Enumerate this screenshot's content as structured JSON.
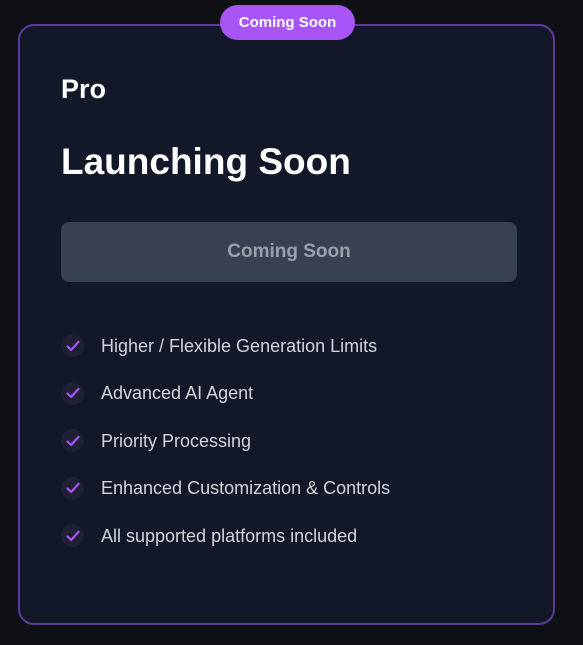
{
  "badge": {
    "label": "Coming Soon"
  },
  "plan": {
    "name": "Pro",
    "headline": "Launching Soon",
    "cta_label": "Coming Soon"
  },
  "features": [
    {
      "label": "Higher / Flexible Generation Limits",
      "icon": "check-icon"
    },
    {
      "label": "Advanced AI Agent",
      "icon": "check-icon"
    },
    {
      "label": "Priority Processing",
      "icon": "check-icon"
    },
    {
      "label": "Enhanced Customization & Controls",
      "icon": "check-icon"
    },
    {
      "label": "All supported platforms included",
      "icon": "check-icon"
    }
  ],
  "colors": {
    "accent": "#a855f7",
    "border": "#5b3a9a",
    "card_background": "#121827",
    "page_background": "#0f1014",
    "button_background": "#374151",
    "button_text": "#9aa1ad"
  }
}
